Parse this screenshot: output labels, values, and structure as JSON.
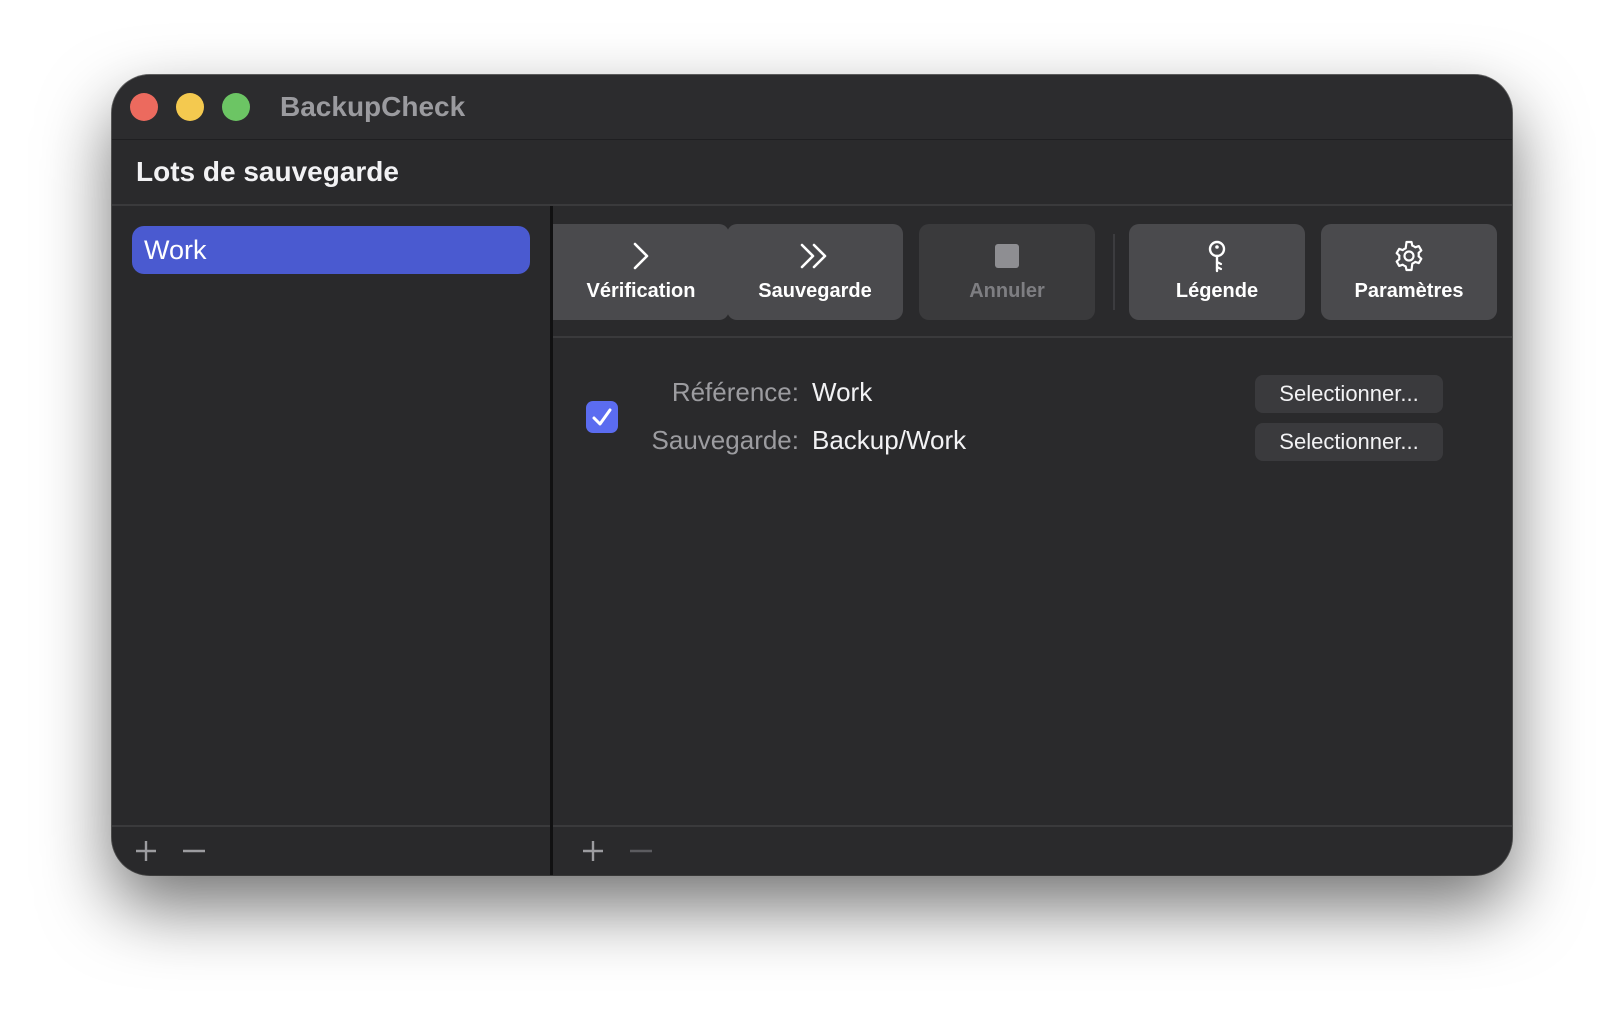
{
  "window": {
    "title": "BackupCheck"
  },
  "header": {
    "title": "Lots de sauvegarde"
  },
  "sidebar": {
    "items": [
      {
        "label": "Work",
        "selected": true
      }
    ],
    "bottom_buttons": [
      "plus-icon",
      "minus-icon"
    ]
  },
  "toolbar": {
    "buttons": [
      {
        "label": "Vérification",
        "icon": "chevron-right-icon",
        "enabled": true
      },
      {
        "label": "Sauvegarde",
        "icon": "double-chevron-right-icon",
        "enabled": true
      },
      {
        "label": "Annuler",
        "icon": "stop-square-icon",
        "enabled": false
      },
      {
        "label": "Légende",
        "icon": "key-icon",
        "enabled": true
      },
      {
        "label": "Paramètres",
        "icon": "gear-icon",
        "enabled": true
      }
    ]
  },
  "pairs": [
    {
      "checked": true,
      "reference_label": "Référence:",
      "reference_value": "Work",
      "backup_label": "Sauvegarde:",
      "backup_value": "Backup/Work",
      "select_reference": "Selectionner...",
      "select_backup": "Selectionner..."
    }
  ],
  "colors": {
    "accent": "#4a5ad0",
    "checkbox": "#5b6cf0",
    "window_bg": "#2a2a2c"
  }
}
